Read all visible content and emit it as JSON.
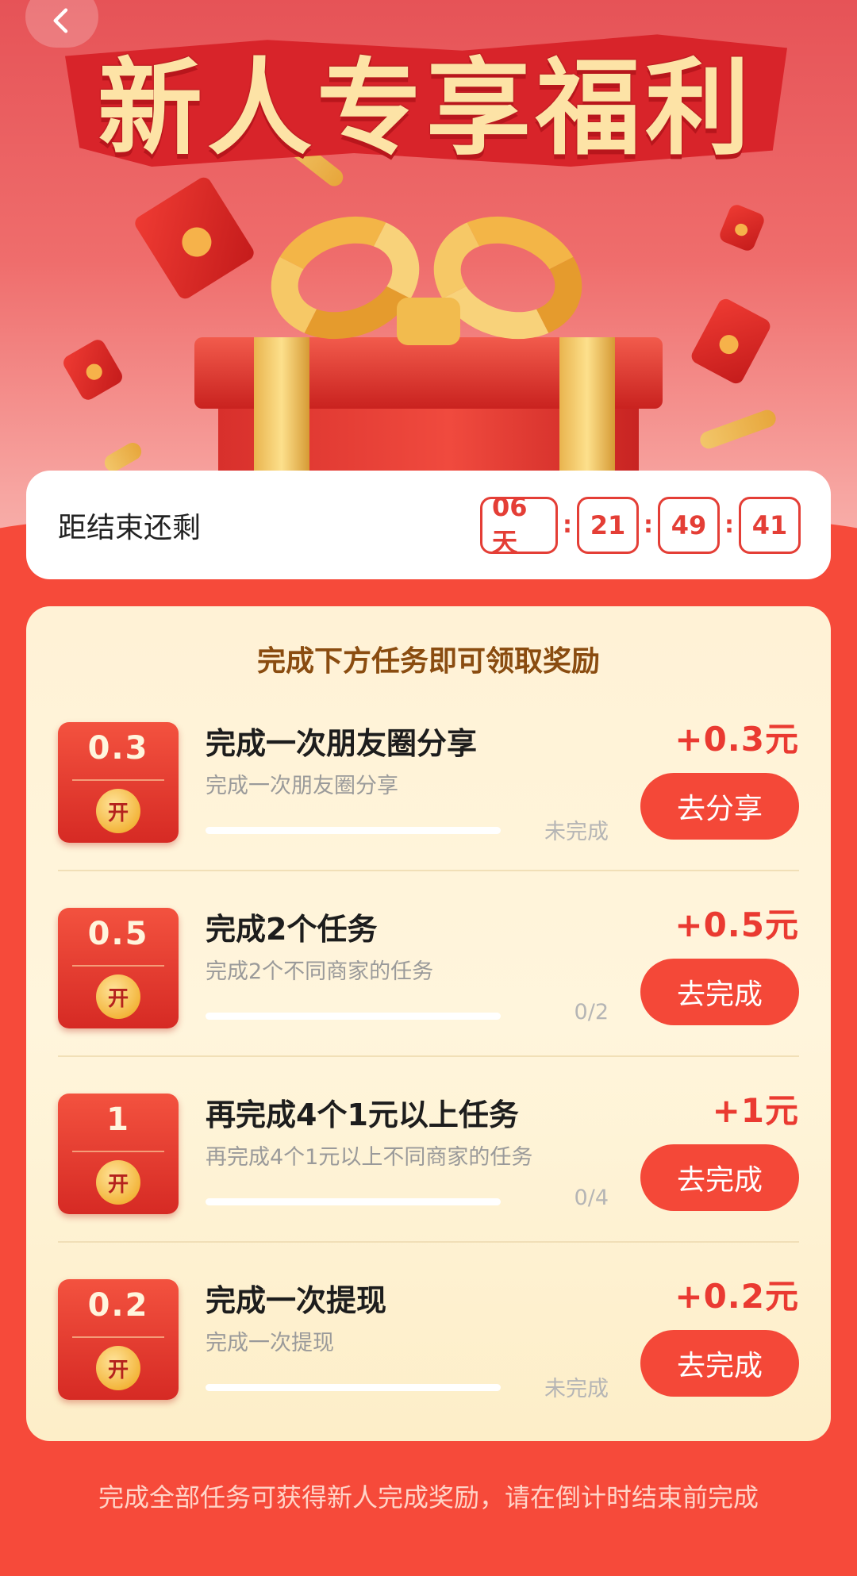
{
  "header": {
    "title": "新人专享福利",
    "back_icon": "chevron-left-icon"
  },
  "countdown": {
    "label": "距结束还剩",
    "days": "06天",
    "hours": "21",
    "minutes": "49",
    "seconds": "41",
    "separator": ":"
  },
  "tasks_card": {
    "title": "完成下方任务即可领取奖励",
    "tasks": [
      {
        "badge_value": "0.3",
        "badge_label": "开",
        "name": "完成一次朋友圈分享",
        "description": "完成一次朋友圈分享",
        "status": "未完成",
        "progress": 0,
        "reward": "+0.3元",
        "button": "去分享"
      },
      {
        "badge_value": "0.5",
        "badge_label": "开",
        "name": "完成2个任务",
        "description": "完成2个不同商家的任务",
        "status": "0/2",
        "progress": 0,
        "reward": "+0.5元",
        "button": "去完成"
      },
      {
        "badge_value": "1",
        "badge_label": "开",
        "name": "再完成4个1元以上任务",
        "description": "再完成4个1元以上不同商家的任务",
        "status": "0/4",
        "progress": 0,
        "reward": "+1元",
        "button": "去完成"
      },
      {
        "badge_value": "0.2",
        "badge_label": "开",
        "name": "完成一次提现",
        "description": "完成一次提现",
        "status": "未完成",
        "progress": 0,
        "reward": "+0.2元",
        "button": "去完成"
      }
    ]
  },
  "footer_note": "完成全部任务可获得新人完成奖励，请在倒计时结束前完成",
  "colors": {
    "accent": "#f44838",
    "reward_text": "#ea3a31",
    "card_bg": "#fff2d6",
    "page_bg": "#f64a3a",
    "title_gold": "#fde3a6"
  }
}
